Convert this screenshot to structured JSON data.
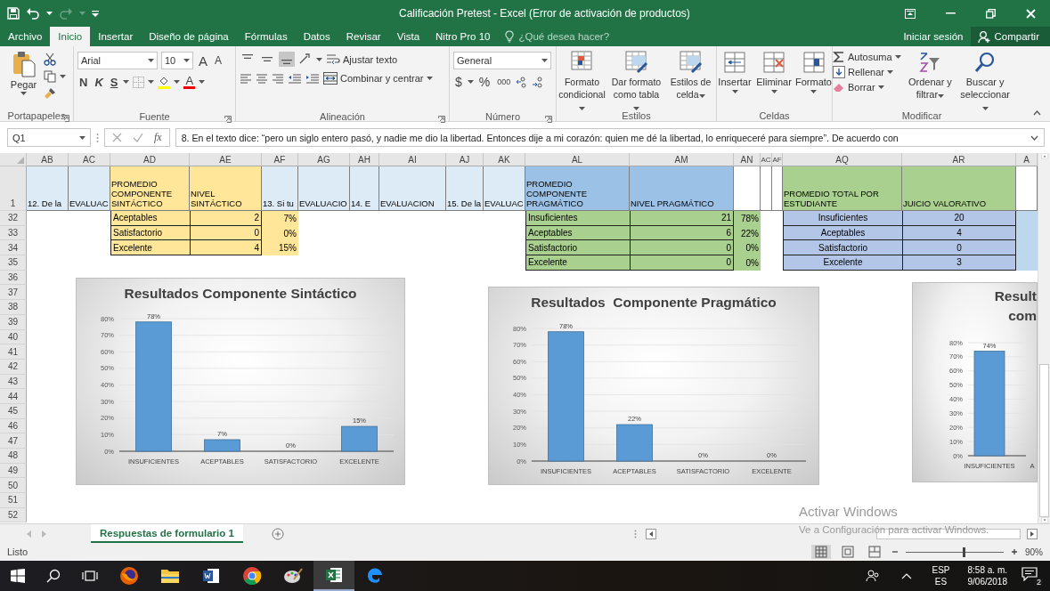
{
  "window": {
    "title": "Calificación Pretest - Excel (Error de activación de productos)"
  },
  "ribbon_tabs": [
    {
      "label": "Archivo",
      "selected": false
    },
    {
      "label": "Inicio",
      "selected": true
    },
    {
      "label": "Insertar",
      "selected": false
    },
    {
      "label": "Diseño de página",
      "selected": false
    },
    {
      "label": "Fórmulas",
      "selected": false
    },
    {
      "label": "Datos",
      "selected": false
    },
    {
      "label": "Revisar",
      "selected": false
    },
    {
      "label": "Vista",
      "selected": false
    },
    {
      "label": "Nitro Pro 10",
      "selected": false
    }
  ],
  "tell_me": {
    "placeholder": "¿Qué desea hacer?"
  },
  "account": {
    "sign_in": "Iniciar sesión",
    "share": "Compartir"
  },
  "ribbon": {
    "clipboard": {
      "label": "Portapapeles",
      "paste": "Pegar"
    },
    "font": {
      "label": "Fuente",
      "font_name": "Arial",
      "font_size": "10",
      "grow": "A",
      "shrink": "A",
      "bold": "N",
      "italic": "K",
      "underline": "S",
      "font_color": "A"
    },
    "alignment": {
      "label": "Alineación",
      "vertical": [
        {
          "selected": false
        },
        {
          "selected": false
        },
        {
          "selected": true
        }
      ],
      "wrap": "Ajustar texto",
      "merge": "Combinar y centrar"
    },
    "number": {
      "label": "Número",
      "format": "General",
      "currency": "$",
      "percent": "%",
      "thousands": "000"
    },
    "styles": {
      "label": "Estilos",
      "buttons": [
        "Formato condicional",
        "Dar formato como tabla",
        "Estilos de celda"
      ]
    },
    "cells": {
      "label": "Celdas",
      "buttons": [
        "Insertar",
        "Eliminar",
        "Formato"
      ]
    },
    "editing": {
      "label": "Modificar",
      "small": [
        "Autosuma",
        "Rellenar",
        "Borrar"
      ],
      "large": [
        "Ordenar y filtrar",
        "Buscar y seleccionar"
      ]
    }
  },
  "formula_bar": {
    "name_box": "Q1",
    "fx": "fx",
    "formula": "8. En el texto dice: “pero  un siglo entero pasó, y nadie me dio la libertad.  Entonces  dije a mi corazón: quien me dé la libertad, lo enriqueceré para siempre”. De acuerdo con"
  },
  "sheet": {
    "columns": [
      "AB",
      "AC",
      "AD",
      "AE",
      "AF",
      "AG",
      "AH",
      "AI",
      "AJ",
      "AK",
      "AL",
      "AM",
      "AN",
      "AC",
      "AF",
      "AQ",
      "AR",
      "A"
    ],
    "header_row": {
      "number": "1",
      "cells": [
        {
          "kind": "text",
          "text": "12.  De la"
        },
        {
          "kind": "text",
          "text": "EVALUAC"
        },
        {
          "kind": "text",
          "text": "PROMEDIO COMPONENTE SINTÁCTICO"
        },
        {
          "kind": "text",
          "text": "NIVEL SINTÁCTICO"
        },
        {
          "kind": "text",
          "text": "13.  Si tu"
        },
        {
          "kind": "text",
          "text": "EVALUACIO"
        },
        {
          "kind": "text",
          "text": "14.   E"
        },
        {
          "kind": "text",
          "text": "EVALUACION"
        },
        {
          "kind": "text",
          "text": "15. De la"
        },
        {
          "kind": "text",
          "text": "EVALUAC"
        },
        {
          "kind": "text",
          "text": "PROMEDIO COMPONENTE PRAGMÁTICO"
        },
        {
          "kind": "text",
          "text": "NIVEL PRAGMÁTICO"
        },
        {
          "kind": "blank"
        },
        {
          "kind": "blank"
        },
        {
          "kind": "blank"
        },
        {
          "kind": "text",
          "text": "PROMEDIO TOTAL POR ESTUDIANTE"
        },
        {
          "kind": "text",
          "text": "JUICIO VALORATIVO"
        },
        {
          "kind": "blank"
        }
      ]
    },
    "row_numbers": [
      "32",
      "33",
      "34",
      "35",
      "36",
      "37",
      "38",
      "39",
      "40",
      "41",
      "42",
      "43",
      "44",
      "45",
      "46",
      "47",
      "48",
      "49",
      "50",
      "51",
      "52"
    ],
    "tables": [
      {
        "rows": [
          [
            "Aceptables",
            "2",
            "7%"
          ],
          [
            "Satisfactorio",
            "0",
            "0%"
          ],
          [
            "Excelente",
            "4",
            "15%"
          ]
        ]
      },
      {
        "rows": [
          [
            "Insuficientes",
            "21",
            "78%"
          ],
          [
            "Aceptables",
            "6",
            "22%"
          ],
          [
            "Satisfactorio",
            "0",
            "0%"
          ],
          [
            "Excelente",
            "0",
            "0%"
          ]
        ]
      },
      {
        "rows": [
          [
            "Insuficientes",
            "20"
          ],
          [
            "Aceptables",
            "4"
          ],
          [
            "Satisfactorio",
            "0"
          ],
          [
            "Excelente",
            "3"
          ]
        ]
      }
    ]
  },
  "charts": [
    {
      "chart_data": {
        "type": "bar",
        "title": "Resultados Componente Sintáctico",
        "categories": [
          "INSUFICIENTES",
          "ACEPTABLES",
          "SATISFACTORIO",
          "EXCELENTE"
        ],
        "values": [
          78,
          7,
          0,
          15
        ],
        "ylim": [
          0,
          80
        ],
        "yticks": [
          {
            "value": 0,
            "label": "0%"
          },
          {
            "value": 10,
            "label": "10%"
          },
          {
            "value": 20,
            "label": "20%"
          },
          {
            "value": 30,
            "label": "30%"
          },
          {
            "value": 40,
            "label": "40%"
          },
          {
            "value": 50,
            "label": "50%"
          },
          {
            "value": 60,
            "label": "60%"
          },
          {
            "value": 70,
            "label": "70%"
          },
          {
            "value": 80,
            "label": "80%"
          }
        ],
        "value_labels": [
          "78%",
          "7%",
          "0%",
          "15%"
        ],
        "grid": true
      }
    },
    {
      "chart_data": {
        "type": "bar",
        "title": "Resultados  Componente Pragmático",
        "categories": [
          "INSUFICIENTES",
          "ACEPTABLES",
          "SATISFACTORIO",
          "EXCELENTE"
        ],
        "values": [
          78,
          22,
          0,
          0
        ],
        "ylim": [
          0,
          80
        ],
        "yticks": [
          {
            "value": 0,
            "label": "0%"
          },
          {
            "value": 10,
            "label": "10%"
          },
          {
            "value": 20,
            "label": "20%"
          },
          {
            "value": 30,
            "label": "30%"
          },
          {
            "value": 40,
            "label": "40%"
          },
          {
            "value": 50,
            "label": "50%"
          },
          {
            "value": 60,
            "label": "60%"
          },
          {
            "value": 70,
            "label": "70%"
          },
          {
            "value": 80,
            "label": "80%"
          }
        ],
        "value_labels": [
          "78%",
          "22%",
          "0%",
          "0%"
        ],
        "grid": true
      }
    },
    {
      "chart_data": {
        "type": "bar",
        "title": "Result com",
        "categories": [
          "INSUFICIENTES",
          "A"
        ],
        "values": [
          74,
          null
        ],
        "ylim": [
          0,
          80
        ],
        "yticks": [
          {
            "value": 0,
            "label": "0%"
          },
          {
            "value": 10,
            "label": "10%"
          },
          {
            "value": 20,
            "label": "20%"
          },
          {
            "value": 30,
            "label": "30%"
          },
          {
            "value": 40,
            "label": "40%"
          },
          {
            "value": 50,
            "label": "50%"
          },
          {
            "value": 60,
            "label": "60%"
          },
          {
            "value": 70,
            "label": "70%"
          },
          {
            "value": 80,
            "label": "80%"
          }
        ],
        "value_labels": [
          "74%",
          null
        ],
        "grid": true
      }
    }
  ],
  "sheet_tabs": [
    {
      "label": "Respuestas de formulario 1",
      "selected": true
    }
  ],
  "activation_notice": {
    "title": "Activar Windows",
    "message": "Ve a Configuración para activar Windows."
  },
  "status_bar": {
    "status": "Listo",
    "zoom": {
      "level": 0.6,
      "reading": "90%"
    }
  },
  "taskbar": {
    "apps": [
      {
        "kind": "firefox",
        "active": false
      },
      {
        "kind": "folder",
        "active": false
      },
      {
        "kind": "word",
        "active": false
      },
      {
        "kind": "chrome",
        "active": false
      },
      {
        "kind": "paint",
        "active": false
      },
      {
        "kind": "excel",
        "active": true
      },
      {
        "kind": "edge",
        "active": false
      }
    ],
    "language": {
      "top": "ESP",
      "bottom": "ES"
    },
    "time": "8:58 a. m.",
    "date": "9/06/2018",
    "notifications": "2"
  }
}
